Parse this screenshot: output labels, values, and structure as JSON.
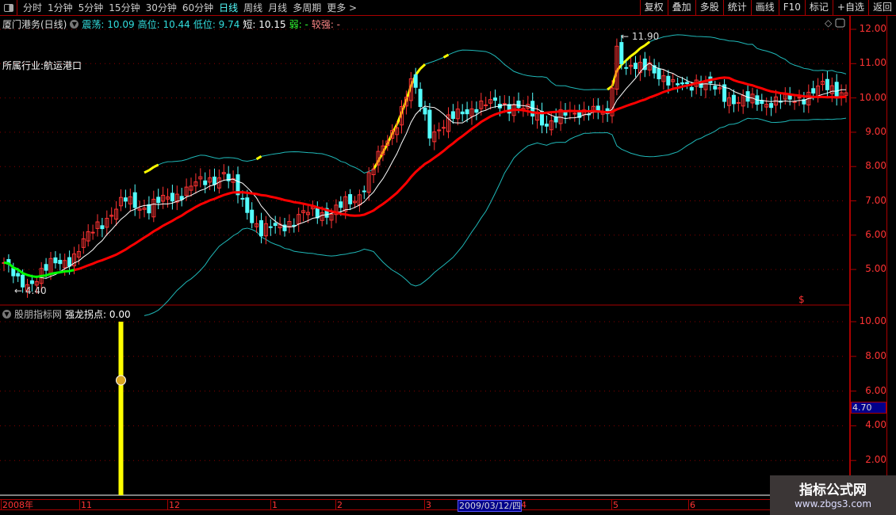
{
  "toolbar": {
    "periods": [
      "分时",
      "1分钟",
      "5分钟",
      "15分钟",
      "30分钟",
      "60分钟",
      "日线",
      "周线",
      "月线",
      "多周期",
      "更多 >"
    ],
    "active_period": "日线",
    "buttons": [
      "复权",
      "叠加",
      "多股",
      "统计",
      "画线",
      "F10",
      "标记",
      "+自选",
      "返回"
    ]
  },
  "info": {
    "title": "厦门港务(日线)",
    "zd_label": "震荡: 10.09",
    "high_label": "高位: 10.44",
    "low_label": "低位: 9.74",
    "short_label": "短: 10.15",
    "weak_label": "弱: -",
    "strong_label": "较强: -"
  },
  "industry": "所属行业:航运港口",
  "annotations": {
    "max": "11.90",
    "min": "4.40"
  },
  "sub": {
    "title": "股朋指标网",
    "indicator": "强龙拐点: 0.00",
    "current_value": "4.70",
    "signal_icon": "coin-icon"
  },
  "price_axis": [
    "12.00",
    "11.00",
    "10.00",
    "9.00",
    "8.00",
    "7.00",
    "6.00",
    "5.00"
  ],
  "sub_axis": [
    "10.00",
    "8.00",
    "6.00",
    "4.00",
    "2.00"
  ],
  "date_axis": [
    "2008年",
    "11",
    "12",
    "1",
    "2",
    "3",
    "4",
    "5",
    "6"
  ],
  "cursor_date": "2009/03/12/四",
  "watermark": {
    "name": "指标公式网",
    "url": "www.zbgs3.com"
  },
  "colors": {
    "up": "#ff3333",
    "down": "#54ffff",
    "ma_short": "#ffffff",
    "ma_long": "#ff0000",
    "band": "#1fb8b8",
    "hot": "#ffff00",
    "weak": "#00ff00"
  },
  "chart_data": {
    "type": "candlestick",
    "ylim": [
      4,
      12.5
    ],
    "close_keypoints": [
      [
        0,
        5.2
      ],
      [
        3,
        4.6
      ],
      [
        5,
        4.6
      ],
      [
        10,
        5.1
      ],
      [
        15,
        5.4
      ],
      [
        20,
        6.3
      ],
      [
        26,
        7.0
      ],
      [
        31,
        6.8
      ],
      [
        40,
        7.4
      ],
      [
        47,
        7.8
      ],
      [
        50,
        7.2
      ],
      [
        55,
        6.1
      ],
      [
        58,
        6.2
      ],
      [
        64,
        6.6
      ],
      [
        70,
        6.7
      ],
      [
        75,
        7.0
      ],
      [
        79,
        8.0
      ],
      [
        83,
        9.0
      ],
      [
        87,
        10.5
      ],
      [
        91,
        9.0
      ],
      [
        96,
        9.4
      ],
      [
        101,
        9.8
      ],
      [
        109,
        9.8
      ],
      [
        116,
        9.3
      ],
      [
        125,
        9.7
      ],
      [
        129,
        9.4
      ],
      [
        131,
        11.5
      ],
      [
        133,
        10.9
      ],
      [
        136,
        10.8
      ],
      [
        138,
        11.0
      ],
      [
        143,
        10.3
      ],
      [
        148,
        10.5
      ],
      [
        157,
        9.9
      ],
      [
        168,
        9.9
      ],
      [
        175,
        10.3
      ],
      [
        180,
        10.2
      ]
    ],
    "sub_signal": {
      "index": 25,
      "value": 10
    }
  }
}
